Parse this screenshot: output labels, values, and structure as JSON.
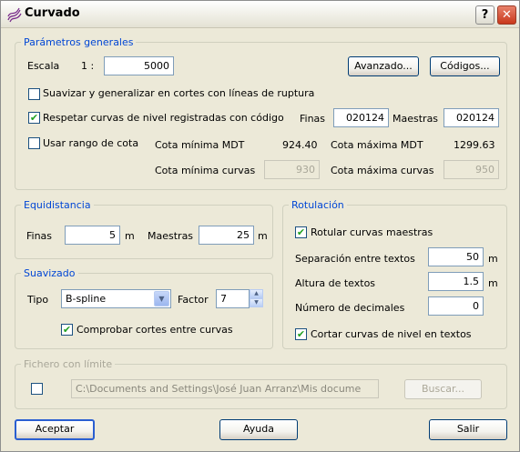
{
  "window": {
    "title": "Curvado",
    "help_glyph": "?",
    "close_glyph": "✕",
    "icon": "contour-lines-icon"
  },
  "general": {
    "legend": "Parámetros generales",
    "escala_label": "Escala",
    "escala_prefix": "1 :",
    "escala_value": "5000",
    "avanzado_label": "Avanzado...",
    "codigos_label": "Códigos...",
    "suavizar_label": "Suavizar y generalizar en cortes con líneas de ruptura",
    "suavizar_checked": false,
    "respetar_label": "Respetar curvas de nivel registradas con código",
    "respetar_checked": true,
    "finas_label": "Finas",
    "finas_code": "020124",
    "maestras_label": "Maestras",
    "maestras_code": "020124",
    "usar_rango_label": "Usar rango de cota",
    "usar_rango_checked": false,
    "cota_min_mdt_label": "Cota mínima MDT",
    "cota_min_mdt_value": "924.40",
    "cota_max_mdt_label": "Cota máxima MDT",
    "cota_max_mdt_value": "1299.63",
    "cota_min_curvas_label": "Cota mínima curvas",
    "cota_min_curvas_value": "930",
    "cota_max_curvas_label": "Cota máxima curvas",
    "cota_max_curvas_value": "950"
  },
  "equidistancia": {
    "legend": "Equidistancia",
    "finas_label": "Finas",
    "finas_value": "5",
    "finas_unit": "m",
    "maestras_label": "Maestras",
    "maestras_value": "25",
    "maestras_unit": "m"
  },
  "suavizado": {
    "legend": "Suavizado",
    "tipo_label": "Tipo",
    "tipo_value": "B-spline",
    "factor_label": "Factor",
    "factor_value": "7",
    "comprobar_label": "Comprobar cortes entre curvas",
    "comprobar_checked": true
  },
  "rotulacion": {
    "legend": "Rotulación",
    "rotular_label": "Rotular curvas maestras",
    "rotular_checked": true,
    "separacion_label": "Separación entre textos",
    "separacion_value": "50",
    "separacion_unit": "m",
    "altura_label": "Altura de textos",
    "altura_value": "1.5",
    "altura_unit": "m",
    "decimales_label": "Número de decimales",
    "decimales_value": "0",
    "cortar_label": "Cortar curvas de nivel en textos",
    "cortar_checked": true
  },
  "fichero": {
    "legend": "Fichero con límite",
    "checked": false,
    "path": "C:\\Documents and Settings\\José Juan Arranz\\Mis docume",
    "buscar_label": "Buscar..."
  },
  "footer": {
    "aceptar_label": "Aceptar",
    "ayuda_label": "Ayuda",
    "salir_label": "Salir"
  }
}
